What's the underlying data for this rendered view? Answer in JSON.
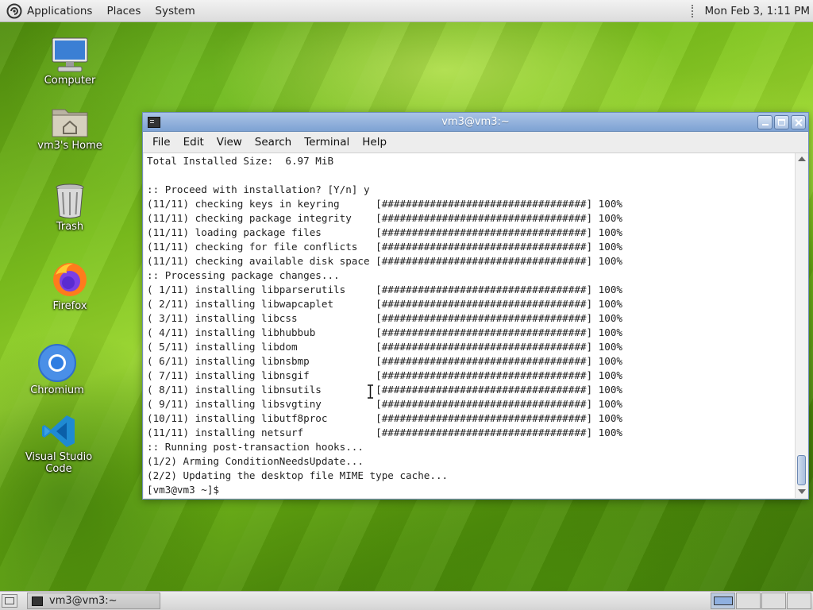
{
  "top_panel": {
    "menus": [
      "Applications",
      "Places",
      "System"
    ],
    "clock": "Mon Feb  3,  1:11 PM"
  },
  "desktop": {
    "icons": [
      {
        "label": "Computer",
        "icon": "computer-icon"
      },
      {
        "label": "vm3's Home",
        "icon": "home-folder-icon"
      },
      {
        "label": "Trash",
        "icon": "trash-icon"
      },
      {
        "label": "Firefox",
        "icon": "firefox-icon"
      },
      {
        "label": "Chromium",
        "icon": "chromium-icon"
      },
      {
        "label": "Visual Studio Code",
        "icon": "vscode-icon"
      }
    ]
  },
  "terminal": {
    "title": "vm3@vm3:~",
    "menus": [
      "File",
      "Edit",
      "View",
      "Search",
      "Terminal",
      "Help"
    ],
    "lines": [
      {
        "text": "Total Installed Size:  6.97 MiB"
      },
      {
        "text": ""
      },
      {
        "text": ":: Proceed with installation? [Y/n] y"
      },
      {
        "text": "(11/11) checking keys in keyring",
        "progress": "[##################################] 100%"
      },
      {
        "text": "(11/11) checking package integrity",
        "progress": "[##################################] 100%"
      },
      {
        "text": "(11/11) loading package files",
        "progress": "[##################################] 100%"
      },
      {
        "text": "(11/11) checking for file conflicts",
        "progress": "[##################################] 100%"
      },
      {
        "text": "(11/11) checking available disk space",
        "progress": "[##################################] 100%"
      },
      {
        "text": ":: Processing package changes..."
      },
      {
        "text": "( 1/11) installing libparserutils",
        "progress": "[##################################] 100%"
      },
      {
        "text": "( 2/11) installing libwapcaplet",
        "progress": "[##################################] 100%"
      },
      {
        "text": "( 3/11) installing libcss",
        "progress": "[##################################] 100%"
      },
      {
        "text": "( 4/11) installing libhubbub",
        "progress": "[##################################] 100%"
      },
      {
        "text": "( 5/11) installing libdom",
        "progress": "[##################################] 100%"
      },
      {
        "text": "( 6/11) installing libnsbmp",
        "progress": "[##################################] 100%"
      },
      {
        "text": "( 7/11) installing libnsgif",
        "progress": "[##################################] 100%"
      },
      {
        "text": "( 8/11) installing libnsutils",
        "progress": "[##################################] 100%"
      },
      {
        "text": "( 9/11) installing libsvgtiny",
        "progress": "[##################################] 100%"
      },
      {
        "text": "(10/11) installing libutf8proc",
        "progress": "[##################################] 100%"
      },
      {
        "text": "(11/11) installing netsurf",
        "progress": "[##################################] 100%"
      },
      {
        "text": ":: Running post-transaction hooks..."
      },
      {
        "text": "(1/2) Arming ConditionNeedsUpdate..."
      },
      {
        "text": "(2/2) Updating the desktop file MIME type cache..."
      },
      {
        "text": "[vm3@vm3 ~]$ "
      }
    ]
  },
  "taskbar": {
    "task_label": "vm3@vm3:~"
  },
  "colors": {
    "titlebar": "#8fb0dd",
    "wallpaper": "#6fb516"
  }
}
